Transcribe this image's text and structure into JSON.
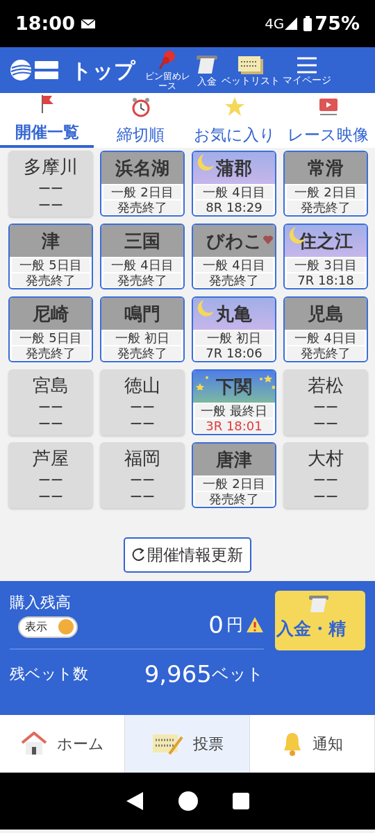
{
  "status_bar": {
    "time": "18:00",
    "network": "4G",
    "battery": "75%"
  },
  "header": {
    "title": "トップ",
    "actions": [
      {
        "kind": "pin",
        "label": "ピン留めレース"
      },
      {
        "kind": "deposit",
        "label": "入金"
      },
      {
        "kind": "betlist",
        "label": "ベットリスト"
      },
      {
        "kind": "menu",
        "label": "マイページ"
      }
    ]
  },
  "tabs": [
    {
      "kind": "flag",
      "label": "開催一覧",
      "selected": true
    },
    {
      "kind": "clock",
      "label": "締切順",
      "selected": false
    },
    {
      "kind": "star",
      "label": "お気に入り",
      "selected": false
    },
    {
      "kind": "video",
      "label": "レース映像",
      "selected": false
    }
  ],
  "venues": [
    {
      "name": "多摩川",
      "kind": "closed",
      "line_1": "ーー",
      "line_2": "ーー",
      "favorite": false
    },
    {
      "name": "浜名湖",
      "kind": "day",
      "line_1": "一般 2日目",
      "line_2": "発売終了",
      "favorite": false,
      "urgent": false
    },
    {
      "name": "蒲郡",
      "kind": "night",
      "line_1": "一般 4日目",
      "line_2": "8R 18:29",
      "favorite": false,
      "urgent": false
    },
    {
      "name": "常滑",
      "kind": "day",
      "line_1": "一般 2日目",
      "line_2": "発売終了",
      "favorite": false,
      "urgent": false
    },
    {
      "name": "津",
      "kind": "day",
      "line_1": "一般 5日目",
      "line_2": "発売終了",
      "favorite": false,
      "urgent": false
    },
    {
      "name": "三国",
      "kind": "day",
      "line_1": "一般 4日目",
      "line_2": "発売終了",
      "favorite": false,
      "urgent": false
    },
    {
      "name": "びわこ",
      "kind": "day",
      "line_1": "一般 4日目",
      "line_2": "発売終了",
      "favorite": true,
      "urgent": false
    },
    {
      "name": "住之江",
      "kind": "night",
      "line_1": "一般 3日目",
      "line_2": "7R 18:18",
      "favorite": false,
      "urgent": false
    },
    {
      "name": "尼崎",
      "kind": "day",
      "line_1": "一般 5日目",
      "line_2": "発売終了",
      "favorite": false,
      "urgent": false
    },
    {
      "name": "鳴門",
      "kind": "day",
      "line_1": "一般 初日",
      "line_2": "発売終了",
      "favorite": false,
      "urgent": false
    },
    {
      "name": "丸亀",
      "kind": "night",
      "line_1": "一般 初日",
      "line_2": "7R 18:06",
      "favorite": false,
      "urgent": false
    },
    {
      "name": "児島",
      "kind": "day",
      "line_1": "一般 4日目",
      "line_2": "発売終了",
      "favorite": false,
      "urgent": false
    },
    {
      "name": "宮島",
      "kind": "closed",
      "line_1": "ーー",
      "line_2": "ーー",
      "favorite": false
    },
    {
      "name": "徳山",
      "kind": "closed",
      "line_1": "ーー",
      "line_2": "ーー",
      "favorite": false
    },
    {
      "name": "下関",
      "kind": "midnight",
      "line_1": "一般 最終日",
      "line_2": "3R 18:01",
      "favorite": false,
      "urgent": true
    },
    {
      "name": "若松",
      "kind": "closed",
      "line_1": "ーー",
      "line_2": "ーー",
      "favorite": false
    },
    {
      "name": "芦屋",
      "kind": "closed",
      "line_1": "ーー",
      "line_2": "ーー",
      "favorite": false
    },
    {
      "name": "福岡",
      "kind": "closed",
      "line_1": "ーー",
      "line_2": "ーー",
      "favorite": false
    },
    {
      "name": "唐津",
      "kind": "day",
      "line_1": "一般 2日目",
      "line_2": "発売終了",
      "favorite": false,
      "urgent": false
    },
    {
      "name": "大村",
      "kind": "closed",
      "line_1": "ーー",
      "line_2": "ーー",
      "favorite": false
    }
  ],
  "refresh_button": "開催情報更新",
  "balance": {
    "label": "購入残高",
    "toggle_label": "表示",
    "on": true,
    "amount": "0",
    "unit": "円",
    "warning": true,
    "deposit_button": "入金・精",
    "bets_label": "残ベット数",
    "bets": "9,965",
    "bets_unit": "ベット"
  },
  "bottom_nav": [
    {
      "kind": "home",
      "label": "ホーム",
      "selected": false
    },
    {
      "kind": "vote",
      "label": "投票",
      "selected": true
    },
    {
      "kind": "bell",
      "label": "通知",
      "selected": false
    }
  ]
}
